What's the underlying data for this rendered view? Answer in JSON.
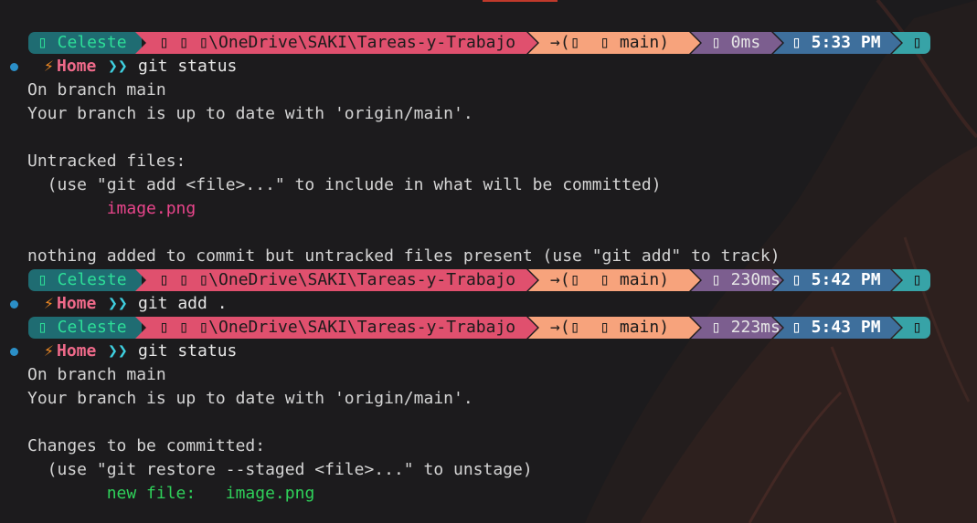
{
  "colors": {
    "background": "#1c1b1d",
    "user_segment": "#1f6c72",
    "path_segment": "#e0506e",
    "git_segment": "#f7a37c",
    "duration_segment": "#7c5e8f",
    "clock_segment": "#3e6f9c",
    "end_segment": "#37a3a7",
    "untracked": "#e8458b",
    "staged": "#2fd15a"
  },
  "prompts": [
    {
      "user": "▯ Celeste",
      "path": "▯ ▯ ▯\\OneDrive\\SAKI\\Tareas-y-Trabajo",
      "git": "→(▯  ▯ main)",
      "duration": "▯ 0ms",
      "clock": "▯ 5:33 PM",
      "end": "▯"
    },
    {
      "user": "▯ Celeste",
      "path": "▯ ▯ ▯\\OneDrive\\SAKI\\Tareas-y-Trabajo",
      "git": "→(▯  ▯ main)",
      "duration": "▯ 230ms",
      "clock": "▯ 5:42 PM",
      "end": "▯"
    },
    {
      "user": "▯ Celeste",
      "path": "▯ ▯ ▯\\OneDrive\\SAKI\\Tareas-y-Trabajo",
      "git": "→(▯  ▯ main)",
      "duration": "▯ 223ms",
      "clock": "▯ 5:43 PM",
      "end": "▯"
    }
  ],
  "prompt_line": {
    "icon": "lightning-icon",
    "bolt": "⚡",
    "home": "Home",
    "chevron": "❯❯"
  },
  "commands": [
    "git status",
    "git add .",
    "git status"
  ],
  "output1": {
    "on_branch": "On branch main",
    "up_to_date": "Your branch is up to date with 'origin/main'.",
    "untracked_header": "Untracked files:",
    "untracked_hint": "  (use \"git add <file>...\" to include in what will be committed)",
    "untracked_file": "        image.png",
    "nothing_added": "nothing added to commit but untracked files present (use \"git add\" to track)"
  },
  "output2": {
    "on_branch": "On branch main",
    "up_to_date": "Your branch is up to date with 'origin/main'.",
    "changes_header": "Changes to be committed:",
    "restore_hint": "  (use \"git restore --staged <file>...\" to unstage)",
    "new_file_label": "        new file:",
    "new_file_name": "   image.png"
  }
}
